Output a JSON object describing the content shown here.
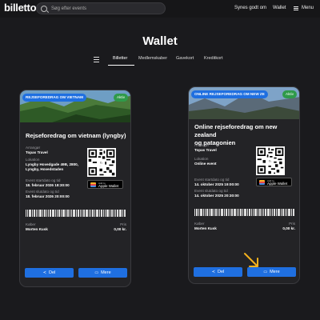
{
  "header": {
    "logo": "billetto.",
    "search_placeholder": "Søg efter events",
    "nav": [
      "Synes godt om",
      "Wallet",
      "Menu"
    ]
  },
  "page": {
    "title": "Wallet"
  },
  "tabs": [
    "Billetter",
    "Medlemskaber",
    "Gavekort",
    "Kreditkort"
  ],
  "labels": {
    "organizer": "Arrangør",
    "location": "Lokation",
    "start": "Event startdato og tid",
    "end": "Event slutdato og tid",
    "buyer": "Køber",
    "price": "Pris",
    "wallet_small": "Add to",
    "wallet_big": "Apple Wallet",
    "share": "Del",
    "more": "Mere"
  },
  "tickets": [
    {
      "tag": "REJSEFOREDRAG OM VIETNAM",
      "status": "Aktiv",
      "title": "Rejseforedrag om vietnam (lyngby)",
      "organizer": "Topas Travel",
      "location_line1": "Lyngby Hovedgade 49B, 2800,",
      "location_line2": "Lyngby, Hovedstaden",
      "start": "18. februar 2026 18:30:00",
      "end": "18. februar 2026 20:00:00",
      "buyer": "Morten Kusk",
      "price": "0,00 kr."
    },
    {
      "tag": "ONLINE REJSEFOREDRAG OM NEW ZE",
      "status": "Aktiv",
      "title_line1": "Online rejseforedrag om new zealand",
      "title_line2": "og patagonien",
      "organizer": "Topas Travel",
      "location": "Online event",
      "start": "14. oktober 2025 19:00:00",
      "end": "14. oktober 2025 20:30:00",
      "buyer": "Morten Kusk",
      "price": "0,00 kr."
    }
  ],
  "colors": {
    "accent": "#1f6fe0",
    "status": "#2f9a4a",
    "arrow": "#f2b01e"
  }
}
